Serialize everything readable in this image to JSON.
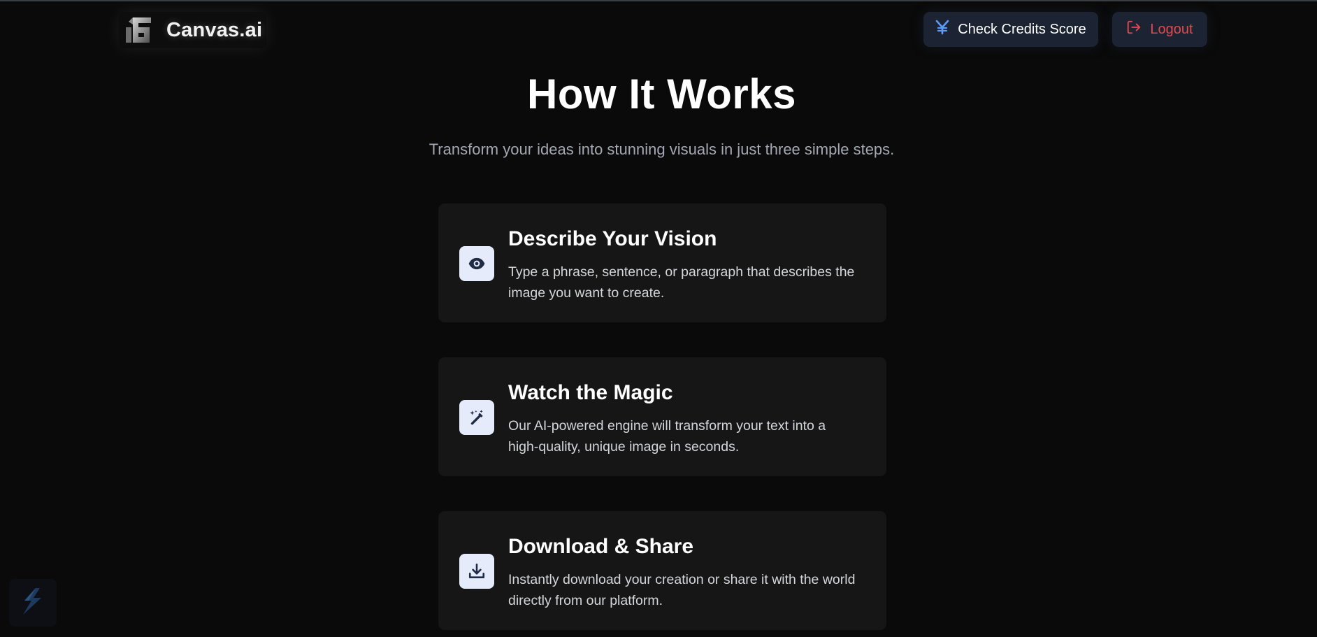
{
  "navbar": {
    "brand_name": "Canvas.ai",
    "credits_label": "Check Credits Score",
    "logout_label": "Logout"
  },
  "hero": {
    "title": "How It Works",
    "subtitle": "Transform your ideas into stunning visuals in just three simple steps."
  },
  "steps": [
    {
      "icon": "eye-icon",
      "title": "Describe Your Vision",
      "description": "Type a phrase, sentence, or paragraph that describes the image you want to create."
    },
    {
      "icon": "magic-wand-icon",
      "title": "Watch the Magic",
      "description": "Our AI-powered engine will transform your text into a high-quality, unique image in seconds."
    },
    {
      "icon": "download-icon",
      "title": "Download & Share",
      "description": "Instantly download your creation or share it with the world directly from our platform."
    }
  ],
  "colors": {
    "background": "#0a0a0a",
    "card": "#161616",
    "button_bg": "#1c2433",
    "icon_bg": "#e5ebfb",
    "accent_blue": "#3b82f6",
    "logout_red": "#e5484d"
  }
}
